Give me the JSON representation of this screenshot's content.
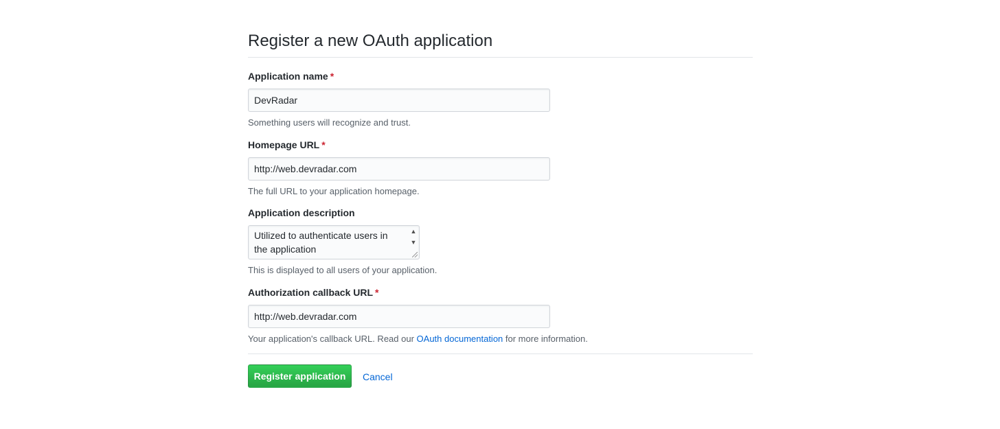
{
  "page": {
    "title": "Register a new OAuth application"
  },
  "form": {
    "required_marker": "*",
    "app_name": {
      "label": "Application name",
      "value": "DevRadar",
      "note": "Something users will recognize and trust."
    },
    "homepage_url": {
      "label": "Homepage URL",
      "value": "http://web.devradar.com",
      "note": "The full URL to your application homepage."
    },
    "description": {
      "label": "Application description",
      "value": "Utilized to authenticate users in the application",
      "note": "This is displayed to all users of your application."
    },
    "callback_url": {
      "label": "Authorization callback URL",
      "value": "http://web.devradar.com",
      "note_prefix": "Your application's callback URL. Read our ",
      "note_link": "OAuth documentation",
      "note_suffix": " for more information."
    }
  },
  "actions": {
    "register_label": "Register application",
    "cancel_label": "Cancel"
  },
  "icons": {
    "scroll_up": "scroll-up-arrow",
    "scroll_down": "scroll-down-arrow",
    "resize": "resize-grip"
  },
  "colors": {
    "primary_button": "#28a745",
    "link": "#0366d6",
    "required": "#cb2431"
  }
}
